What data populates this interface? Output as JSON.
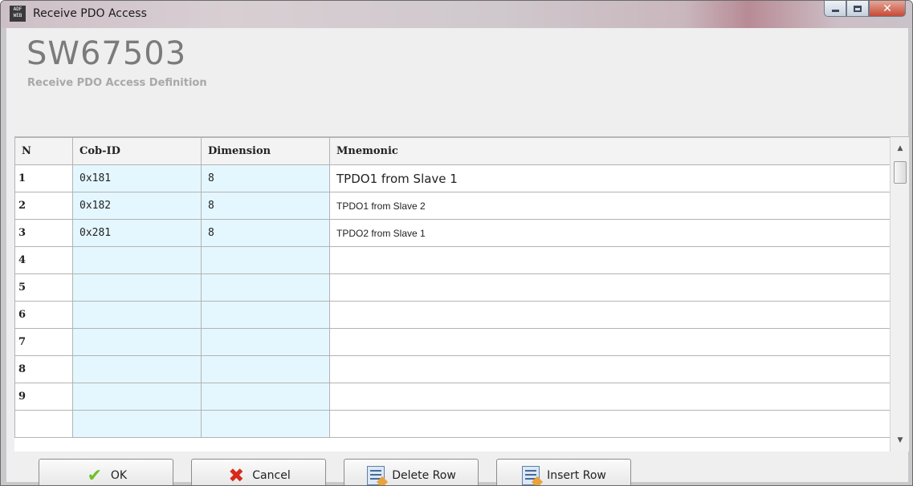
{
  "window": {
    "title": "Receive PDO Access",
    "icon": "adfweb-app-icon",
    "icon_text": "ADF WEB",
    "controls": [
      "minimize",
      "maximize",
      "close"
    ]
  },
  "header": {
    "title": "SW67503",
    "subtitle": "Receive PDO Access Definition"
  },
  "table": {
    "columns": [
      "N",
      "Cob-ID",
      "Dimension",
      "Mnemonic"
    ],
    "rows": [
      {
        "n": "1",
        "cob_id": "0x181",
        "dimension": "8",
        "mnemonic": "TPDO1 from Slave 1"
      },
      {
        "n": "2",
        "cob_id": "0x182",
        "dimension": "8",
        "mnemonic": "TPDO1 from Slave 2"
      },
      {
        "n": "3",
        "cob_id": "0x281",
        "dimension": "8",
        "mnemonic": "TPDO2 from Slave 1"
      },
      {
        "n": "4",
        "cob_id": "",
        "dimension": "",
        "mnemonic": ""
      },
      {
        "n": "5",
        "cob_id": "",
        "dimension": "",
        "mnemonic": ""
      },
      {
        "n": "6",
        "cob_id": "",
        "dimension": "",
        "mnemonic": ""
      },
      {
        "n": "7",
        "cob_id": "",
        "dimension": "",
        "mnemonic": ""
      },
      {
        "n": "8",
        "cob_id": "",
        "dimension": "",
        "mnemonic": ""
      },
      {
        "n": "9",
        "cob_id": "",
        "dimension": "",
        "mnemonic": ""
      },
      {
        "n": "",
        "cob_id": "",
        "dimension": "",
        "mnemonic": ""
      }
    ]
  },
  "buttons": {
    "ok": {
      "label": "OK",
      "icon": "check-icon"
    },
    "cancel": {
      "label": "Cancel",
      "icon": "x-icon"
    },
    "delete_row": {
      "label": "Delete Row",
      "icon": "delete-row-icon"
    },
    "insert_row": {
      "label": "Insert Row",
      "icon": "insert-row-icon"
    }
  },
  "colors": {
    "editable_cell_bg": "#e4f7ff",
    "header_title": "#7b7b7b",
    "ok_icon": "#6fbf2a",
    "cancel_icon": "#d62a1a"
  }
}
